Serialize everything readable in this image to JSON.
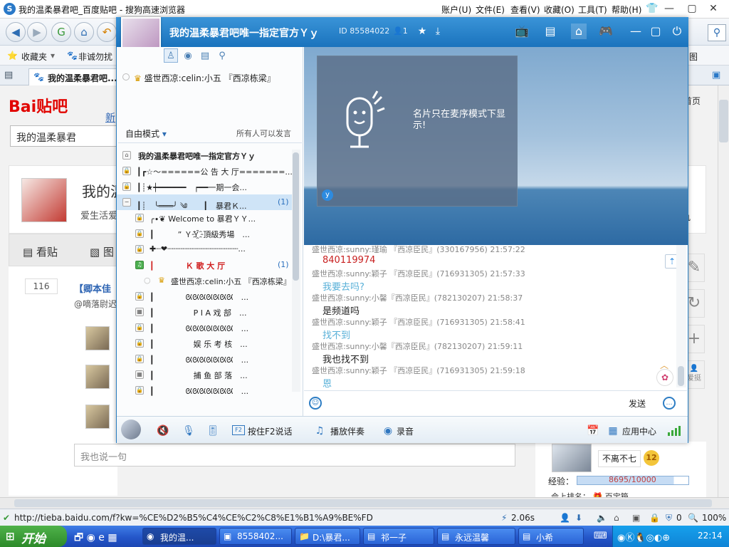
{
  "browser": {
    "title": "我的温柔暴君吧_百度贴吧 - 搜狗高速浏览器",
    "menu": [
      "账户(U)",
      "文件(E)",
      "查看(V)",
      "收藏(O)",
      "工具(T)",
      "帮助(H)"
    ],
    "bookmarks": [
      "收藏夹",
      "非诚勿扰"
    ],
    "tab_title": "我的温柔暴君吧...",
    "url": "http://tieba.baidu.com/f?kw=%CE%D2%B5%C4%CE%C2%C8%E1%B1%A9%BE%FD",
    "load_time": "2.06s",
    "zoom": "100%",
    "status_num": "0",
    "right_snippets": [
      "图",
      "首页"
    ]
  },
  "tieba": {
    "logo": "Bai贴吧",
    "search_value": "我的温柔暴君",
    "forum_name": "我的温柔暴君吧",
    "slogan": "爱生活爱",
    "tab_kanr": "看贴",
    "tab_tu": "图",
    "post_count": "116",
    "post_title": "【卿本佳",
    "post_user": "@嘀落尉迟",
    "reply_placeholder": "我也说一句",
    "user_name": "不离不七",
    "level": "12",
    "exp_label": "经验：",
    "exp_value": "8695/10000",
    "exp_progress": 0.87,
    "bottom_snip": "会上排名：",
    "bottom_snip2": "百宝箱"
  },
  "yy": {
    "channel_title": "我的温柔暴君吧唯一指定官方Ｙｙ",
    "channel_id": "ID 85584022",
    "online_count": "1",
    "mic_user": "盛世西凉:celin:小五 『西凉栋梁』",
    "mode": "自由模式",
    "mode_info": "所有人可以发言",
    "channels": [
      {
        "name": "我的温柔暴君吧唯一指定官方Ｙｙ",
        "icon": "home",
        "indent": 30,
        "count": ""
      },
      {
        "name": "┃┏☆～======公 告 大 厅=======...",
        "icon": "lock",
        "indent": 28,
        "count": ""
      },
      {
        "name": "┃┊★┿━━━━━━　┍━━一期一会...",
        "icon": "lock",
        "indent": 28,
        "count": ""
      },
      {
        "name": "┃┊　╰═══╯ ༄　　┃　暴君Ｋ...",
        "icon": "minus",
        "indent": 28,
        "count": "(1)"
      },
      {
        "name": "╭∙❦ Welcome to 暴君ＹＹ...",
        "icon": "lock",
        "indent": 46,
        "count": ""
      },
      {
        "name": "┃　　　” ＹＹ҈頂級秀場　...",
        "icon": "lock",
        "indent": 46,
        "count": ""
      },
      {
        "name": "✚┈❤┈┈┈┈┈┈┈┈┈┈┈┈┈┈┈...",
        "icon": "lock",
        "indent": 46,
        "count": ""
      },
      {
        "name": "┃　　　　Ｋ 歌 大 厅　　",
        "icon": "song",
        "indent": 46,
        "count": "(1)"
      },
      {
        "name": "盛世西凉:celin:小五 『西凉栋梁』",
        "icon": "user",
        "indent": 76,
        "count": ""
      },
      {
        "name": "┃　　　　ᘡᘡᘡᘡᘡᘡᘡ　...",
        "icon": "lock",
        "indent": 46,
        "count": ""
      },
      {
        "name": "┃　　　　　P I A 戏 部　...",
        "icon": "grid",
        "indent": 46,
        "count": ""
      },
      {
        "name": "┃　　　　ᘡᘡᘡᘡᘡᘡᘡ　...",
        "icon": "lock",
        "indent": 46,
        "count": ""
      },
      {
        "name": "┃　　　　　娱 乐 考 核　...",
        "icon": "lock",
        "indent": 46,
        "count": ""
      },
      {
        "name": "┃　　　　ᘡᘡᘡᘡᘡᘡᘡ　...",
        "icon": "lock",
        "indent": 46,
        "count": ""
      },
      {
        "name": "┃　　　　　捕 鱼 部 落　...",
        "icon": "grid",
        "indent": 46,
        "count": ""
      },
      {
        "name": "┃　　　　ᘡᘡᘡᘡᘡᘡᘡ　...",
        "icon": "lock",
        "indent": 46,
        "count": ""
      }
    ],
    "card_text": "名片只在麦序模式下显示!",
    "chat": [
      {
        "meta": "盛世西凉:sunny:瑾瑜 『西凉臣民』(330167956) 21:57:22",
        "text": "840119974",
        "color": "#c82020"
      },
      {
        "meta": "盛世西凉:sunny:颖子 『西凉臣民』(716931305) 21:57:33",
        "text": "我要去吗?",
        "color": "#58b0d8"
      },
      {
        "meta": "盛世西凉:sunny:小馨『西凉臣民』(782130207) 21:58:37",
        "text": "是频道吗",
        "color": "#222222"
      },
      {
        "meta": "盛世西凉:sunny:颖子 『西凉臣民』(716931305) 21:58:41",
        "text": "找不到",
        "color": "#58b0d8"
      },
      {
        "meta": "盛世西凉:sunny:小馨『西凉臣民』(782130207) 21:59:11",
        "text": "我也找不到",
        "color": "#222222"
      },
      {
        "meta": "盛世西凉:sunny:颖子 『西凉臣民』(716931305) 21:59:18",
        "text": "恩",
        "color": "#58b0d8"
      }
    ],
    "send_label": "发送",
    "bottom": {
      "ptt": "按住F2说话",
      "play": "播放伴奏",
      "record": "录音",
      "app_center": "应用中心",
      "f2_key": "F2"
    }
  },
  "taskbar": {
    "start": "开始",
    "tasks": [
      "我的温...",
      "8558402...",
      "D:\\暴君...",
      "祁一子",
      "永远温馨",
      "小希"
    ],
    "clock": "22:14"
  }
}
